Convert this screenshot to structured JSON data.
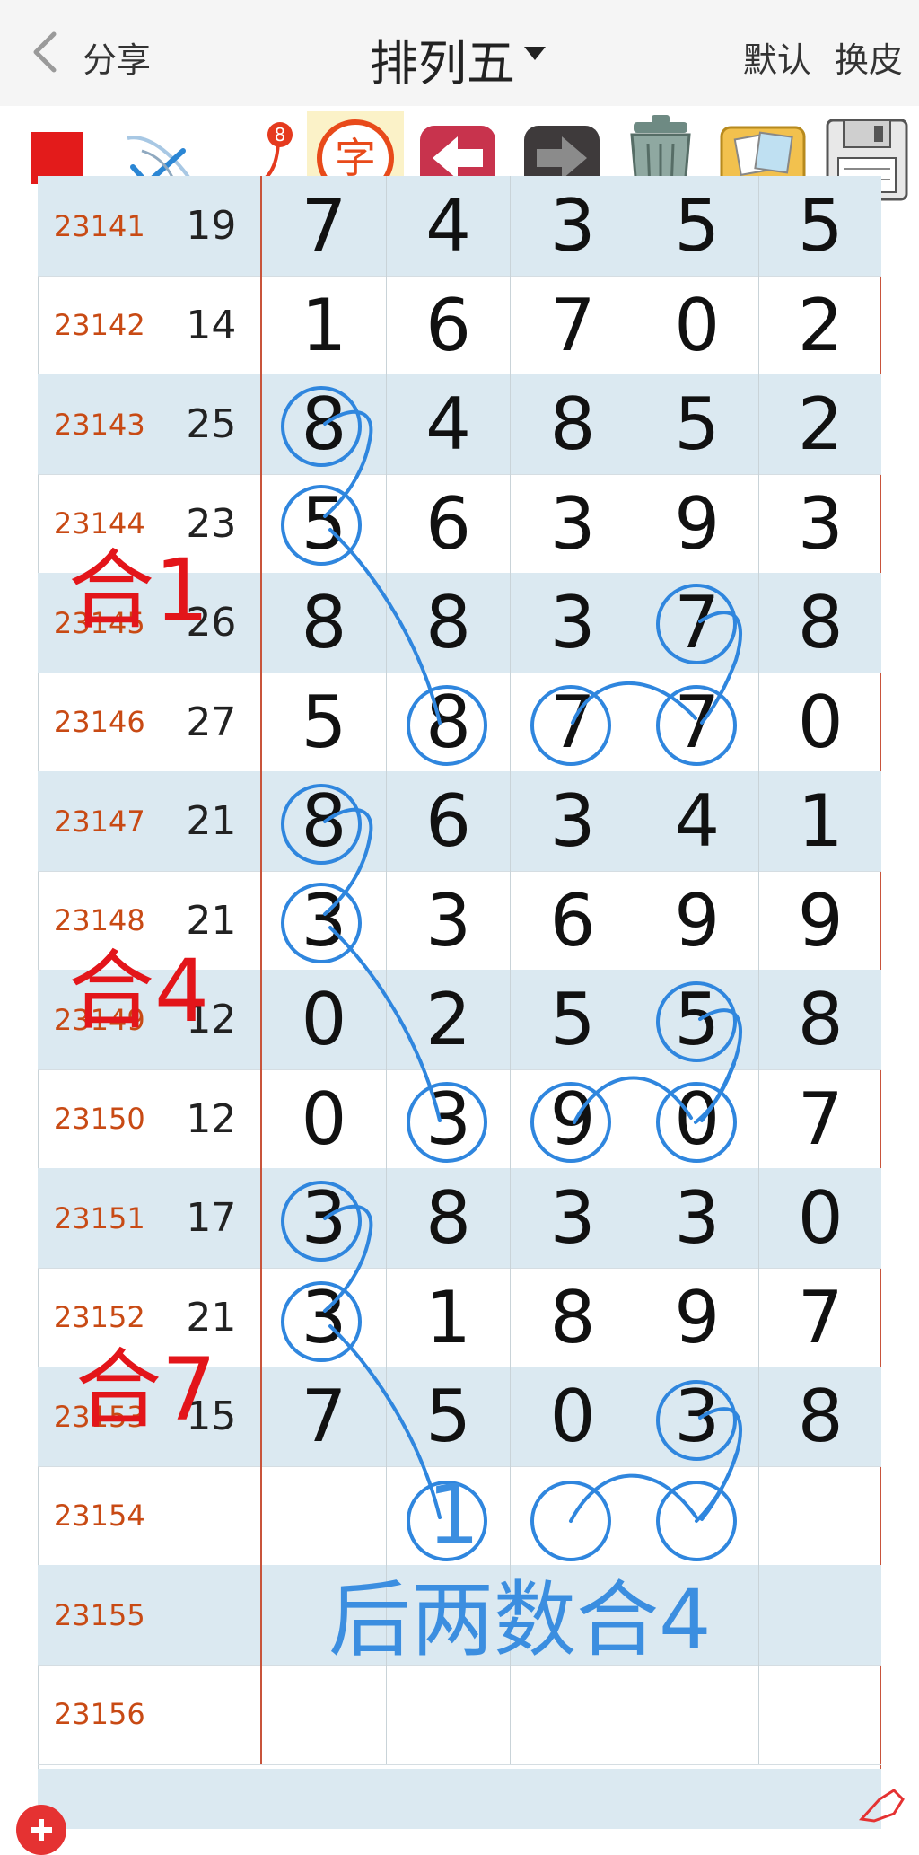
{
  "header": {
    "share_label": "分享",
    "title": "排列五",
    "default_label": "默认",
    "skin_label": "换皮"
  },
  "toolbar": {
    "tools": [
      {
        "name": "red-square-icon",
        "color": "#e31b1b"
      },
      {
        "name": "pen-check-icon"
      },
      {
        "name": "line-6-8-icon",
        "from": "6",
        "to": "8"
      },
      {
        "name": "text-char-icon",
        "char": "字"
      },
      {
        "name": "undo-arrow-icon"
      },
      {
        "name": "redo-arrow-icon"
      },
      {
        "name": "trash-icon"
      },
      {
        "name": "gallery-icon"
      },
      {
        "name": "save-floppy-icon"
      }
    ]
  },
  "table": {
    "rows": [
      {
        "period": "23141",
        "sum": "19",
        "d": [
          "7",
          "4",
          "3",
          "5",
          "5"
        ]
      },
      {
        "period": "23142",
        "sum": "14",
        "d": [
          "1",
          "6",
          "7",
          "0",
          "2"
        ]
      },
      {
        "period": "23143",
        "sum": "25",
        "d": [
          "8",
          "4",
          "8",
          "5",
          "2"
        ]
      },
      {
        "period": "23144",
        "sum": "23",
        "d": [
          "5",
          "6",
          "3",
          "9",
          "3"
        ]
      },
      {
        "period": "23145",
        "sum": "26",
        "d": [
          "8",
          "8",
          "3",
          "7",
          "8"
        ]
      },
      {
        "period": "23146",
        "sum": "27",
        "d": [
          "5",
          "8",
          "7",
          "7",
          "0"
        ]
      },
      {
        "period": "23147",
        "sum": "21",
        "d": [
          "8",
          "6",
          "3",
          "4",
          "1"
        ]
      },
      {
        "period": "23148",
        "sum": "21",
        "d": [
          "3",
          "3",
          "6",
          "9",
          "9"
        ]
      },
      {
        "period": "23149",
        "sum": "12",
        "d": [
          "0",
          "2",
          "5",
          "5",
          "8"
        ]
      },
      {
        "period": "23150",
        "sum": "12",
        "d": [
          "0",
          "3",
          "9",
          "0",
          "7"
        ]
      },
      {
        "period": "23151",
        "sum": "17",
        "d": [
          "3",
          "8",
          "3",
          "3",
          "0"
        ]
      },
      {
        "period": "23152",
        "sum": "21",
        "d": [
          "3",
          "1",
          "8",
          "9",
          "7"
        ]
      },
      {
        "period": "23153",
        "sum": "15",
        "d": [
          "7",
          "5",
          "0",
          "3",
          "8"
        ]
      },
      {
        "period": "23154",
        "sum": "",
        "d": [
          "",
          "",
          "",
          "",
          ""
        ]
      },
      {
        "period": "23155",
        "sum": "",
        "d": [
          "",
          "",
          "",
          "",
          ""
        ]
      },
      {
        "period": "23156",
        "sum": "",
        "d": [
          "",
          "",
          "",
          "",
          ""
        ]
      }
    ]
  },
  "annotations": {
    "he1": "合1",
    "he4": "合4",
    "he7": "合7",
    "handwritten_one": "1",
    "bottom_note": "后两数合4"
  },
  "colors": {
    "row_shade": "#dbe9f1",
    "separator": "#c8543b",
    "period_text": "#c84a14",
    "annotation_red": "#e3151a",
    "annotation_blue": "#3b8ee0"
  }
}
